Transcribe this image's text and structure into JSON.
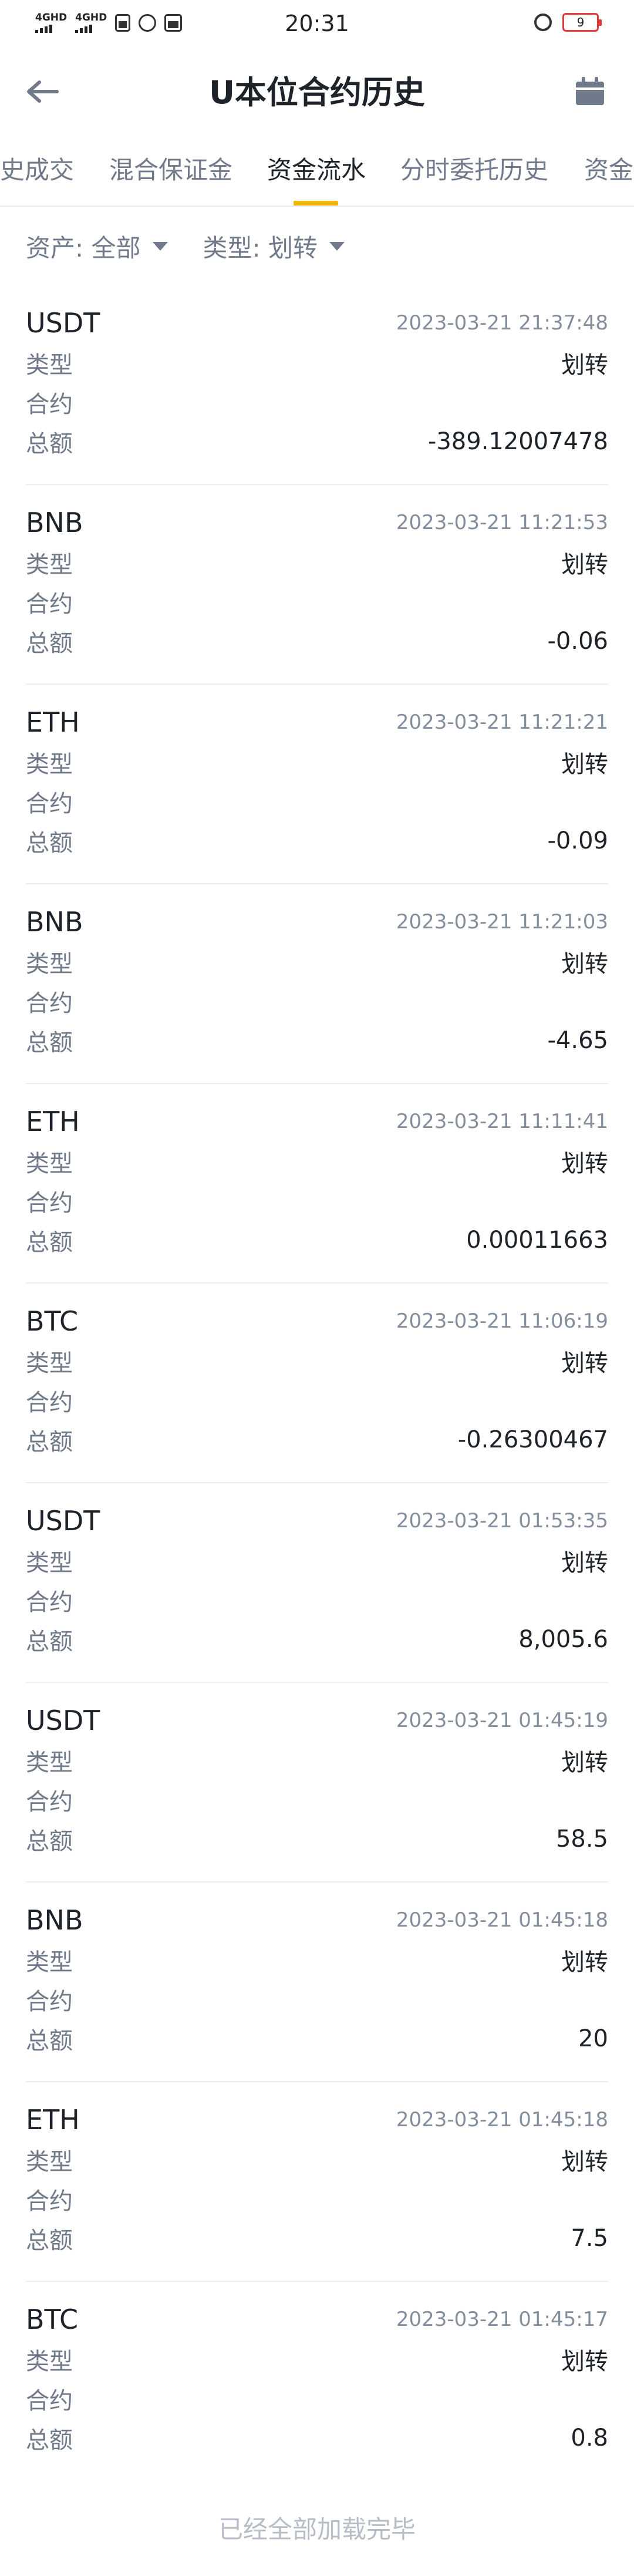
{
  "status_bar": {
    "network_1": "4GHD",
    "network_2": "4GHD",
    "time": "20:31",
    "battery": "9"
  },
  "header": {
    "title": "U本位合约历史"
  },
  "tabs": [
    {
      "label": "史成交"
    },
    {
      "label": "混合保证金"
    },
    {
      "label": "资金流水",
      "active": true
    },
    {
      "label": "分时委托历史"
    },
    {
      "label": "资金"
    }
  ],
  "filters": {
    "asset": "资产: 全部",
    "type": "类型: 划转"
  },
  "labels": {
    "type": "类型",
    "contract": "合约",
    "amount": "总额"
  },
  "records": [
    {
      "asset": "USDT",
      "time": "2023-03-21 21:37:48",
      "type": "划转",
      "contract": "",
      "amount": "-389.12007478"
    },
    {
      "asset": "BNB",
      "time": "2023-03-21 11:21:53",
      "type": "划转",
      "contract": "",
      "amount": "-0.06"
    },
    {
      "asset": "ETH",
      "time": "2023-03-21 11:21:21",
      "type": "划转",
      "contract": "",
      "amount": "-0.09"
    },
    {
      "asset": "BNB",
      "time": "2023-03-21 11:21:03",
      "type": "划转",
      "contract": "",
      "amount": "-4.65"
    },
    {
      "asset": "ETH",
      "time": "2023-03-21 11:11:41",
      "type": "划转",
      "contract": "",
      "amount": "0.00011663"
    },
    {
      "asset": "BTC",
      "time": "2023-03-21 11:06:19",
      "type": "划转",
      "contract": "",
      "amount": "-0.26300467"
    },
    {
      "asset": "USDT",
      "time": "2023-03-21 01:53:35",
      "type": "划转",
      "contract": "",
      "amount": "8,005.6"
    },
    {
      "asset": "USDT",
      "time": "2023-03-21 01:45:19",
      "type": "划转",
      "contract": "",
      "amount": "58.5"
    },
    {
      "asset": "BNB",
      "time": "2023-03-21 01:45:18",
      "type": "划转",
      "contract": "",
      "amount": "20"
    },
    {
      "asset": "ETH",
      "time": "2023-03-21 01:45:18",
      "type": "划转",
      "contract": "",
      "amount": "7.5"
    },
    {
      "asset": "BTC",
      "time": "2023-03-21 01:45:17",
      "type": "划转",
      "contract": "",
      "amount": "0.8"
    }
  ],
  "footer": {
    "message": "已经全部加载完毕"
  },
  "colors": {
    "accent": "#f0b90b",
    "text_primary": "#1e2329",
    "text_secondary": "#707a8a",
    "divider": "#eaecef",
    "battery_low": "#e33a3a"
  },
  "icons": {
    "back": "arrow-left-icon",
    "calendar": "calendar-icon",
    "caret": "caret-down-icon"
  }
}
